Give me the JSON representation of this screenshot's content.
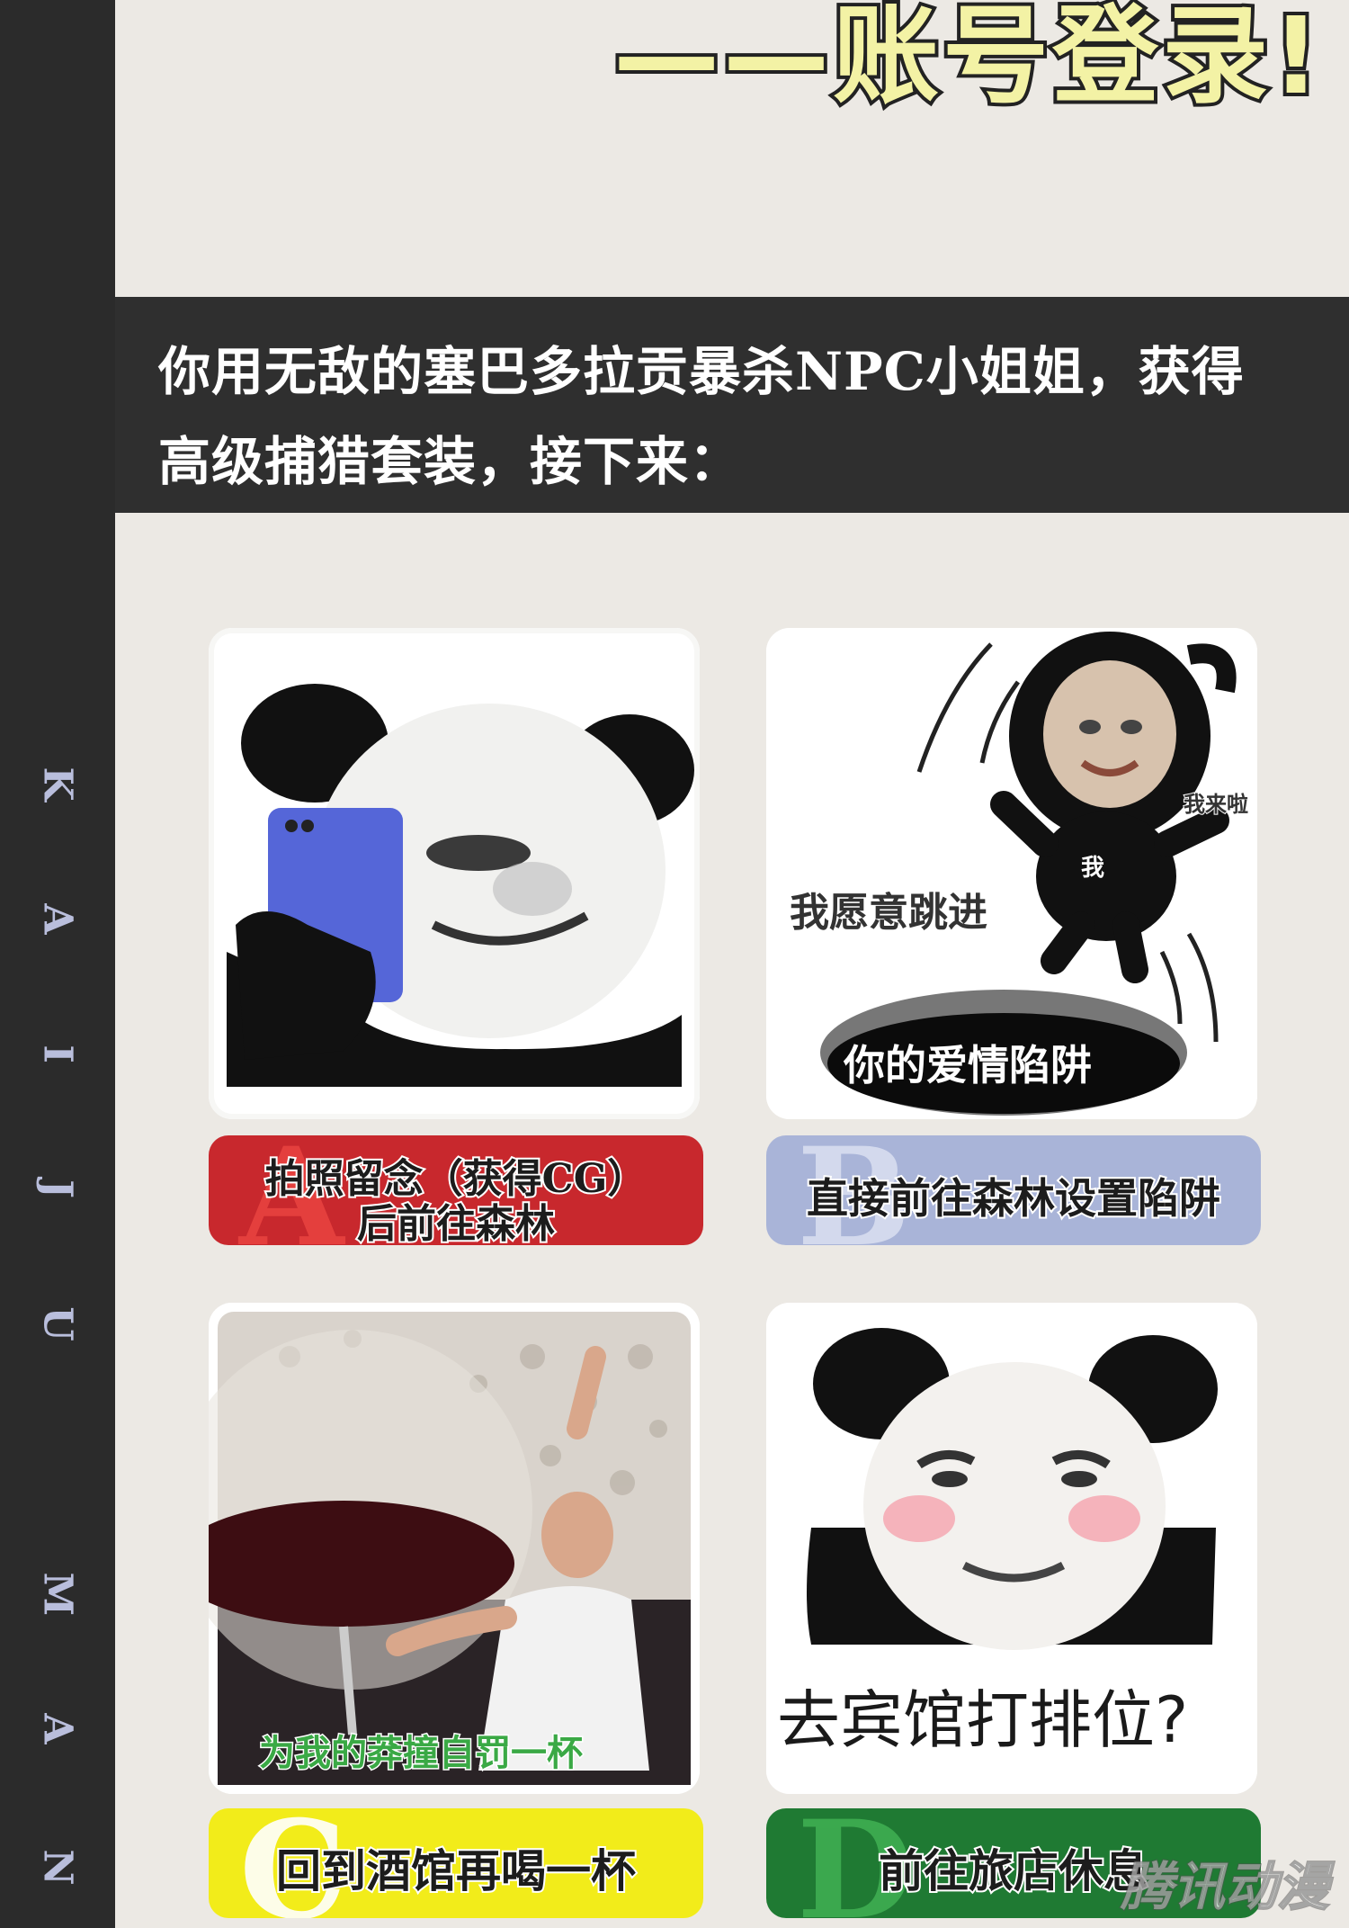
{
  "sidebar": {
    "letters": [
      "K",
      "A",
      "I",
      "J",
      "U",
      "M",
      "A",
      "N"
    ]
  },
  "header": {
    "title": "——账号登录!"
  },
  "intro": {
    "line1": "你用无敌的塞巴多拉贡暴杀NPC小姐姐，获得",
    "line2": "高级捕猎套装，接下来："
  },
  "options": [
    {
      "letter": "A",
      "text_line1": "拍照留念（获得CG）",
      "text_line2": "后前往森林",
      "color": "#c8282d",
      "letter_color": "#e8423f",
      "image": "panda-meme-with-phone"
    },
    {
      "letter": "B",
      "text_line1": "直接前往森林设置陷阱",
      "color": "#a9b4d8",
      "letter_color": "#d8def0",
      "image": "jumping-into-trap-meme",
      "captions": [
        "我愿意跳进",
        "你的爱情陷阱",
        "我",
        "我来啦"
      ]
    },
    {
      "letter": "C",
      "text_line1": "回到酒馆再喝一杯",
      "color": "#f2ec1a",
      "letter_color": "#ffffff",
      "image": "giant-wine-glass-meme",
      "captions": [
        "为我的莽撞自罚一杯"
      ]
    },
    {
      "letter": "D",
      "text_line1": "前往旅店休息",
      "color": "#1f7a33",
      "letter_color": "#3fae52",
      "image": "blushing-panda-meme",
      "captions": [
        "去宾馆打排位?"
      ]
    }
  ],
  "watermark": "腾讯动漫"
}
